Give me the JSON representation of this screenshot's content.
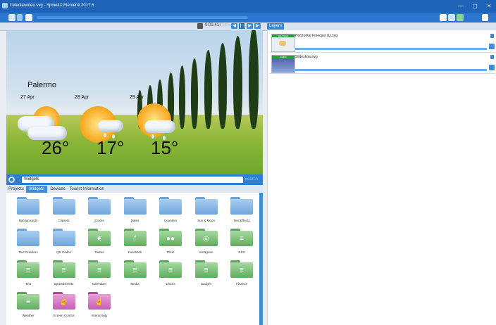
{
  "window": {
    "title": "f:Media\\video.svg - SpinetiX Elementi 2017.5",
    "controls": [
      "—",
      "▢",
      "✕"
    ]
  },
  "playback": {
    "time": "0:01:41 / -----"
  },
  "layers_panel": {
    "tab": "Layers",
    "items": [
      {
        "name": "Horizontal Forecast (1).svg",
        "tag": "WEATHER"
      },
      {
        "name": "Slideshow.svg",
        "tag": "MEDIA"
      }
    ]
  },
  "preview": {
    "city": "Palermo",
    "days": [
      {
        "date": "27 Apr",
        "temp": "26°"
      },
      {
        "date": "28 Apr",
        "temp": "17°"
      },
      {
        "date": "29 Apr",
        "temp": "15°"
      }
    ]
  },
  "library": {
    "search_value": "Widgets",
    "search_button": "Search",
    "tabs": [
      "Projects",
      "Widgets",
      "Devices",
      "Tourist Information"
    ],
    "active_tab": "Widgets",
    "items": [
      {
        "label": "Backgrounds",
        "color": "blue",
        "icon": "folder-icon"
      },
      {
        "label": "Clipsets",
        "color": "blue",
        "icon": "folder-icon"
      },
      {
        "label": "Clocks",
        "color": "blue",
        "icon": "folder-icon"
      },
      {
        "label": "Dates",
        "color": "blue",
        "icon": "folder-icon"
      },
      {
        "label": "Counters",
        "color": "blue",
        "icon": "folder-icon"
      },
      {
        "label": "Sun & Moon",
        "color": "blue",
        "icon": "folder-icon"
      },
      {
        "label": "Text Effects",
        "color": "blue",
        "icon": "folder-icon"
      },
      {
        "label": "Text Crawlers",
        "color": "blue",
        "icon": "folder-icon"
      },
      {
        "label": "QR Codes",
        "color": "blue",
        "icon": "folder-icon"
      },
      {
        "label": "Twitter",
        "color": "green",
        "icon": "twitter-icon"
      },
      {
        "label": "Facebook",
        "color": "green",
        "icon": "facebook-icon"
      },
      {
        "label": "Flickr",
        "color": "green",
        "icon": "flickr-icon"
      },
      {
        "label": "Instagram",
        "color": "green",
        "icon": "instagram-icon"
      },
      {
        "label": "RSS",
        "color": "green",
        "icon": "feed-icon"
      },
      {
        "label": "Text",
        "color": "green",
        "icon": "feed-icon"
      },
      {
        "label": "Spreadsheets",
        "color": "green",
        "icon": "feed-icon"
      },
      {
        "label": "Calendars",
        "color": "green",
        "icon": "feed-icon"
      },
      {
        "label": "Media",
        "color": "green",
        "icon": "feed-icon"
      },
      {
        "label": "Charts",
        "color": "green",
        "icon": "feed-icon"
      },
      {
        "label": "Gauges",
        "color": "green",
        "icon": "feed-icon"
      },
      {
        "label": "Finance",
        "color": "green",
        "icon": "feed-icon"
      },
      {
        "label": "Weather",
        "color": "green",
        "icon": "feed-icon"
      },
      {
        "label": "Screen Control",
        "color": "pink",
        "icon": "touch-icon"
      },
      {
        "label": "Interactivity",
        "color": "pink",
        "icon": "touch-icon"
      }
    ]
  },
  "colors": {
    "titlebar": "#1f63b8",
    "accent": "#3e8ed9",
    "folder_blue": "#6ea6dc",
    "folder_green": "#5fae5f",
    "folder_pink": "#c55db5"
  }
}
